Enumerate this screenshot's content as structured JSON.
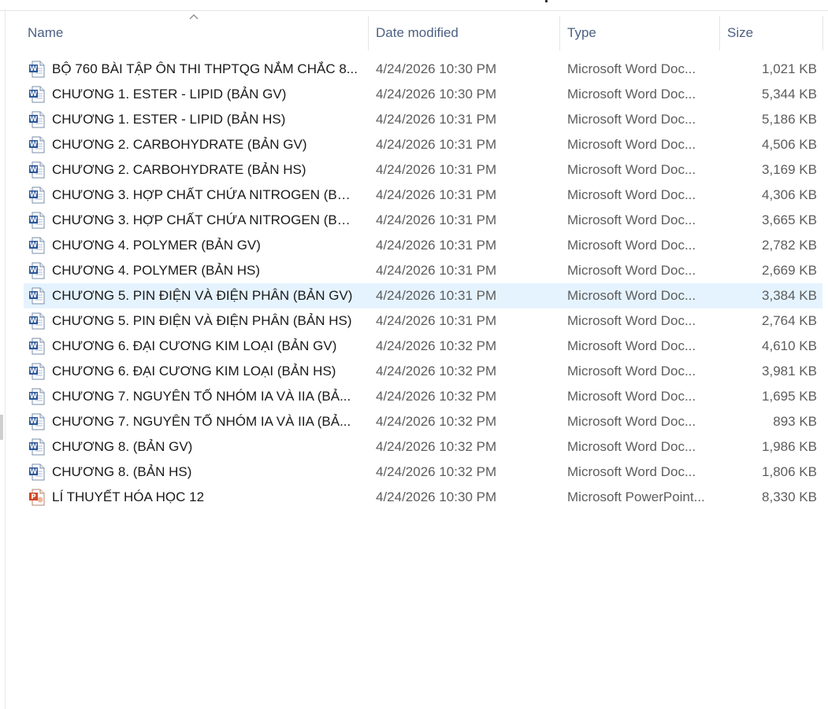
{
  "columns": {
    "name": "Name",
    "date": "Date modified",
    "type": "Type",
    "size": "Size"
  },
  "sort": {
    "column": "name",
    "direction": "ascending"
  },
  "colors": {
    "header_text": "#4d6082",
    "selection": "#e5f3ff",
    "word_icon": "#2b579a",
    "ppt_icon": "#d24726"
  },
  "files": [
    {
      "name": "BỘ 760 BÀI TẬP ÔN THI THPTQG NẮM CHẮC 8...",
      "date": "4/24/2026 10:30 PM",
      "type": "Microsoft Word Doc...",
      "size": "1,021 KB",
      "icon": "word-doc-icon"
    },
    {
      "name": "CHƯƠNG 1. ESTER - LIPID (BẢN GV)",
      "date": "4/24/2026 10:30 PM",
      "type": "Microsoft Word Doc...",
      "size": "5,344 KB",
      "icon": "word-doc-icon"
    },
    {
      "name": "CHƯƠNG 1. ESTER - LIPID (BẢN HS)",
      "date": "4/24/2026 10:31 PM",
      "type": "Microsoft Word Doc...",
      "size": "5,186 KB",
      "icon": "word-doc-icon"
    },
    {
      "name": "CHƯƠNG 2. CARBOHYDRATE (BẢN GV)",
      "date": "4/24/2026 10:31 PM",
      "type": "Microsoft Word Doc...",
      "size": "4,506 KB",
      "icon": "word-doc-icon"
    },
    {
      "name": "CHƯƠNG 2. CARBOHYDRATE (BẢN HS)",
      "date": "4/24/2026 10:31 PM",
      "type": "Microsoft Word Doc...",
      "size": "3,169 KB",
      "icon": "word-doc-icon"
    },
    {
      "name": "CHƯƠNG 3. HỢP CHẤT CHỨA NITROGEN (BẢN...",
      "date": "4/24/2026 10:31 PM",
      "type": "Microsoft Word Doc...",
      "size": "4,306 KB",
      "icon": "word-doc-icon"
    },
    {
      "name": "CHƯƠNG 3. HỢP CHẤT CHỨA NITROGEN (BẢN...",
      "date": "4/24/2026 10:31 PM",
      "type": "Microsoft Word Doc...",
      "size": "3,665 KB",
      "icon": "word-doc-icon"
    },
    {
      "name": "CHƯƠNG 4. POLYMER (BẢN GV)",
      "date": "4/24/2026 10:31 PM",
      "type": "Microsoft Word Doc...",
      "size": "2,782 KB",
      "icon": "word-doc-icon"
    },
    {
      "name": "CHƯƠNG 4. POLYMER (BẢN HS)",
      "date": "4/24/2026 10:31 PM",
      "type": "Microsoft Word Doc...",
      "size": "2,669 KB",
      "icon": "word-doc-icon"
    },
    {
      "name": "CHƯƠNG 5. PIN ĐIỆN VÀ ĐIỆN PHÂN (BẢN GV)",
      "date": "4/24/2026 10:31 PM",
      "type": "Microsoft Word Doc...",
      "size": "3,384 KB",
      "icon": "word-doc-icon",
      "selected": true
    },
    {
      "name": "CHƯƠNG 5. PIN ĐIỆN VÀ ĐIỆN PHÂN (BẢN HS)",
      "date": "4/24/2026 10:31 PM",
      "type": "Microsoft Word Doc...",
      "size": "2,764 KB",
      "icon": "word-doc-icon"
    },
    {
      "name": "CHƯƠNG 6. ĐẠI CƯƠNG KIM LOẠI (BẢN GV)",
      "date": "4/24/2026 10:32 PM",
      "type": "Microsoft Word Doc...",
      "size": "4,610 KB",
      "icon": "word-doc-icon"
    },
    {
      "name": "CHƯƠNG 6. ĐẠI CƯƠNG KIM LOẠI (BẢN HS)",
      "date": "4/24/2026 10:32 PM",
      "type": "Microsoft Word Doc...",
      "size": "3,981 KB",
      "icon": "word-doc-icon"
    },
    {
      "name": "CHƯƠNG 7. NGUYÊN TỐ NHÓM IA VÀ IIA (BẢ...",
      "date": "4/24/2026 10:32 PM",
      "type": "Microsoft Word Doc...",
      "size": "1,695 KB",
      "icon": "word-doc-icon"
    },
    {
      "name": "CHƯƠNG 7. NGUYÊN TỐ NHÓM IA VÀ IIA (BẢ...",
      "date": "4/24/2026 10:32 PM",
      "type": "Microsoft Word Doc...",
      "size": "893 KB",
      "icon": "word-doc-icon"
    },
    {
      "name": "CHƯƠNG 8. (BẢN GV)",
      "date": "4/24/2026 10:32 PM",
      "type": "Microsoft Word Doc...",
      "size": "1,986 KB",
      "icon": "word-doc-icon"
    },
    {
      "name": "CHƯƠNG 8. (BẢN HS)",
      "date": "4/24/2026 10:32 PM",
      "type": "Microsoft Word Doc...",
      "size": "1,806 KB",
      "icon": "word-doc-icon"
    },
    {
      "name": "LÍ THUYẾT HÓA HỌC 12",
      "date": "4/24/2026 10:30 PM",
      "type": "Microsoft PowerPoint...",
      "size": "8,330 KB",
      "icon": "powerpoint-icon"
    }
  ]
}
